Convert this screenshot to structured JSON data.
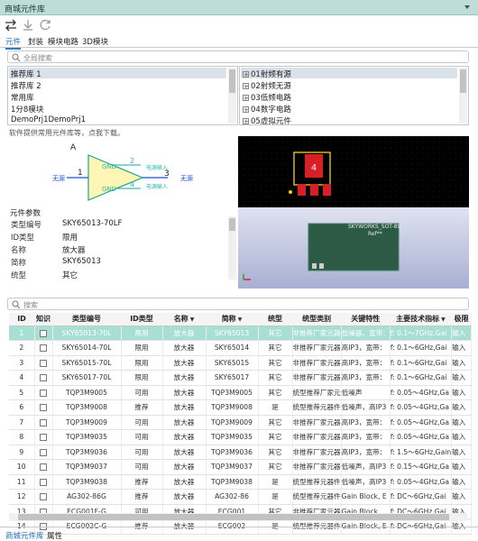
{
  "window": {
    "title": "商城元件库"
  },
  "tabs": [
    {
      "label": "元件"
    },
    {
      "label": "封装"
    },
    {
      "label": "模块电路"
    },
    {
      "label": "3D模块"
    }
  ],
  "search_top": {
    "placeholder": "全局搜索"
  },
  "libraries": {
    "items": [
      "推荐库 1",
      "推荐库 2",
      "常用库",
      "1分8模块",
      "DemoPrj1DemoPrj1"
    ],
    "selected_index": 0
  },
  "categories": {
    "items": [
      "01射频有源",
      "02射频无源",
      "03低频电路",
      "04数字电路",
      "05虚拟元件"
    ],
    "selected_index": 0
  },
  "hint_text": "软件提供常用元件库等，点我下载。",
  "symbol": {
    "ref": "A",
    "pin1_num": "1",
    "pin2_num": "2",
    "pin3_num": "3",
    "pin4_num": "4",
    "left_label": "无源",
    "right_label": "无源",
    "gnd_top": "GND",
    "gnd_bottom": "GND",
    "power_top": "电源输入",
    "power_bottom": "电源输入"
  },
  "footprint": {
    "pad_number": "4"
  },
  "model3d": {
    "label1": "SKYWORKS_SOT-89",
    "label2": "Ref**"
  },
  "params": {
    "header": "元件参数",
    "rows": [
      {
        "key": "类型编号",
        "value": "SKY65013-70LF"
      },
      {
        "key": "ID类型",
        "value": "限用"
      },
      {
        "key": "名称",
        "value": "放大器"
      },
      {
        "key": "简称",
        "value": "SKY65013"
      },
      {
        "key": "统型",
        "value": "其它"
      }
    ]
  },
  "search_bottom": {
    "placeholder": "搜索"
  },
  "table": {
    "columns": [
      "ID",
      "知识",
      "类型编号",
      "ID类型",
      "名称",
      "简称",
      "统型",
      "统型类别",
      "关键特性",
      "主要技术指标",
      "极限"
    ],
    "rows": [
      [
        "1",
        "SKY65013-70L",
        "限用",
        "放大器",
        "SKY65013",
        "其它",
        "非推荐厂家元器",
        "低噪器，宽带：",
        "f: 0.1～7GHz,Gai",
        "输入"
      ],
      [
        "2",
        "SKY65014-70L",
        "限用",
        "放大器",
        "SKY65014",
        "其它",
        "非推荐厂家元器",
        "高IP3，宽带：",
        "f: 0.1～6GHz,Gai",
        "输入"
      ],
      [
        "3",
        "SKY65015-70L",
        "限用",
        "放大器",
        "SKY65015",
        "其它",
        "非推荐厂家元器",
        "高IP3，宽带：",
        "f: 0.1～6GHz,Gai",
        "输入"
      ],
      [
        "4",
        "SKY65017-70L",
        "限用",
        "放大器",
        "SKY65017",
        "其它",
        "非推荐厂家元器",
        "高IP3，宽带：",
        "f: 0.1～6GHz,Gai",
        "输入"
      ],
      [
        "5",
        "TQP3M9005",
        "可用",
        "放大器",
        "TQP3M9005",
        "其它",
        "统型推荐厂家元",
        "低噪声",
        "f: 0.05～4GHz,Ga",
        "输入"
      ],
      [
        "6",
        "TQP3M9008",
        "推荐",
        "放大器",
        "TQP3M9008",
        "是",
        "统型推荐元器件",
        "低噪声，高IP3",
        "f: 0.05～4GHz,Ga",
        "输入"
      ],
      [
        "7",
        "TQP3M9009",
        "可用",
        "放大器",
        "TQP3M9009",
        "其它",
        "非推荐厂家元器",
        "高IP3，宽带：",
        "f: 0.05～4GHz,Ga",
        "输入"
      ],
      [
        "8",
        "TQP3M9035",
        "可用",
        "放大器",
        "TQP3M9035",
        "其它",
        "非推荐厂家元器",
        "高IP3，宽带：",
        "f: 0.05～4GHz,Ga",
        "输入"
      ],
      [
        "9",
        "TQP3M9036",
        "可用",
        "放大器",
        "TQP3M9036",
        "其它",
        "非推荐厂家元器",
        "高IP3，宽带：",
        "f: 1.5～6GHz,Gain",
        "输入"
      ],
      [
        "10",
        "TQP3M9037",
        "可用",
        "放大器",
        "TQP3M9037",
        "其它",
        "非推荐厂家元器",
        "低噪声，高IP3",
        "f: 0.15～4GHz,Ga",
        "输入"
      ],
      [
        "11",
        "TQP3M9038",
        "推荐",
        "放大器",
        "TQP3M9038",
        "是",
        "统型推荐元器件",
        "低噪声，高IP3",
        "f: 0.05～4GHz,Ga",
        "输入"
      ],
      [
        "12",
        "AG302-86G",
        "推荐",
        "放大器",
        "AG302-86",
        "是",
        "统型推荐元器件",
        "Gain Block, E",
        "f: DC～6GHz,Gai",
        "输入"
      ],
      [
        "13",
        "ECG001F-G",
        "可用",
        "放大器",
        "ECG001",
        "其它",
        "非推荐厂家元器",
        "Gain Block",
        "f: DC～6GHz,Gai",
        "输入"
      ],
      [
        "14",
        "ECG002C-G",
        "推荐",
        "放大器",
        "ECG002",
        "是",
        "统型推荐元器件",
        "Gain Block, E",
        "f: DC～6GHz,Gai",
        "输入"
      ]
    ],
    "selected_row": 0
  },
  "bottom_tabs": [
    {
      "label": "商城元件库"
    },
    {
      "label": "属性"
    }
  ],
  "colors": {
    "titlebar": "#bfdcd8",
    "selected_row": "#a7dfd3",
    "schematic_teal": "#2eb8ad",
    "triangle_fill": "#fff6b5",
    "triangle_stroke": "#1aa696",
    "pin_blue": "#1a4fd6",
    "footprint_bg": "#000000",
    "pad_red": "#d81f26",
    "outline_yellow": "#f3d21a",
    "board_green": "#2d5a45",
    "viewer_bg": "#c4c9e3"
  }
}
